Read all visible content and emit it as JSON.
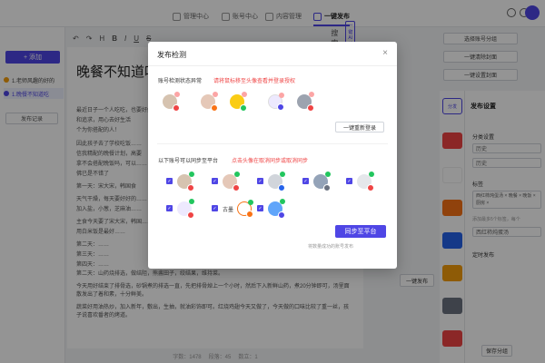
{
  "nav": {
    "items": [
      {
        "label": "管理中心"
      },
      {
        "label": "账号中心"
      },
      {
        "label": "内容管理"
      },
      {
        "label": "一键发布"
      }
    ]
  },
  "left": {
    "add_label": "+ 添加",
    "docs": [
      {
        "label": "1.老师风趣的好的"
      },
      {
        "label": "1.晚餐不知道吃"
      }
    ],
    "record_label": "发布记录"
  },
  "toolbar": {
    "search_label": "搜索",
    "ai_label": "一键AI排版"
  },
  "editor": {
    "title": "晚餐不知道吃什么？重样，荤素搭",
    "paragraphs": [
      "最近日子一个人吃吃，也要好好吃饭……",
      "和追求，用心去好生活",
      "个为你搭配的人！",
      "因此孩子去了学校吃饭……",
      "信我精配的晚餐计划，高要",
      "拿不会搭配晚饭吗，可以……",
      "佛已是不错了",
      "第一天：宋大宋，韩国食",
      "天气干燥，每天要好好的……",
      "加入盐，小葱，芝麻油……",
      "主食今天要了宋大宋，韩国……",
      "用白米饭是最好……",
      "第二天：……",
      "第三天：……",
      "第四天：……",
      "第二天：山药烧排选，做结阻，熊酱田子，绞结果，维持菜。",
      "今天用好结束了排骨选，砂锅煮的排选一直，先把排骨焯上一个小时，然后下入新鲜山药，煮20分钟即可，汤里面散发出了着和素，十分鲜美。",
      "蔬菜好用油热炒，加入新年，敷出，生抽，就油彩饰即可。红烧鸡翅今天又做了，今天做的口味比较了重一丝，孩子说喜欢番者的烤道。"
    ]
  },
  "footer": {
    "words": "字数：1478",
    "paragraphs": "段落：45",
    "count": "数立：1"
  },
  "actions": {
    "select_group": "选择账号分组",
    "clear_all": "一键清除封面",
    "set_cover": "一键设置封面",
    "set_tags": "一键设置标签",
    "publish_side": "一键发布",
    "save": "保存分组"
  },
  "settings": {
    "tab_label": "分发",
    "title": "发布设置",
    "category_label": "分类设置",
    "category_value": "历史",
    "category_value2": "历史",
    "tag_label": "标签",
    "tag_values": "西红柿炖蛋汤 × 晚餐 × 晚饭 × 厨房 ×",
    "tag_hint": "添加最多5个标签，每个",
    "tag_value2": "西红柿炖蛋汤",
    "timing_label": "定时发布"
  },
  "modal": {
    "title": "发布检测",
    "close": "×",
    "abnormal_label": "账号检测状态异常",
    "abnormal_hint": "请将鼠标移至头像查看并登录授权",
    "relogin": "一键重新登录",
    "sync_label": "以下账号可以同步至平台",
    "sync_hint": "点击头像在取消同步或取消同步",
    "accounts_row2_names": [
      "古墨"
    ],
    "sync_button": "同步至平台",
    "sync_footnote": "将数量成功的账号发布"
  },
  "colors": {
    "accent": "#4f46e5",
    "warn": "#ef4444",
    "ok": "#22c55e"
  }
}
